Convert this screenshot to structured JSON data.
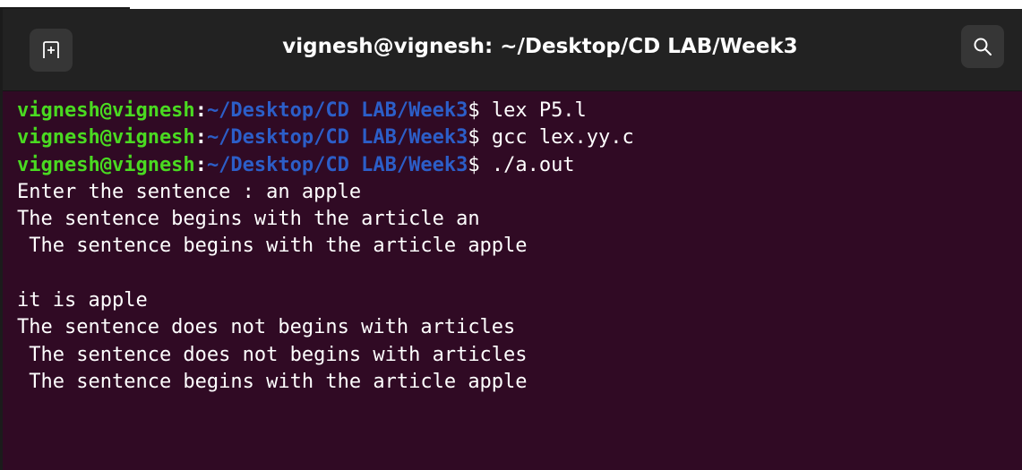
{
  "window": {
    "title": "vignesh@vignesh: ~/Desktop/CD LAB/Week3"
  },
  "icons": {
    "new_tab": "new-tab-icon",
    "search": "search-icon"
  },
  "colors": {
    "background": "#300a24",
    "titlebar": "#222222",
    "prompt_user": "#4ada21",
    "prompt_path": "#2c5ec8",
    "text": "#ffffff"
  },
  "terminal": {
    "prompts": [
      {
        "user": "vignesh@vignesh",
        "sep": ":",
        "path": "~/Desktop/CD LAB/Week3",
        "symbol": "$",
        "command": " lex P5.l"
      },
      {
        "user": "vignesh@vignesh",
        "sep": ":",
        "path": "~/Desktop/CD LAB/Week3",
        "symbol": "$",
        "command": " gcc lex.yy.c"
      },
      {
        "user": "vignesh@vignesh",
        "sep": ":",
        "path": "~/Desktop/CD LAB/Week3",
        "symbol": "$",
        "command": " ./a.out"
      }
    ],
    "output": [
      "Enter the sentence : an apple",
      "The sentence begins with the article an",
      " The sentence begins with the article apple",
      "",
      "it is apple",
      "The sentence does not begins with articles",
      " The sentence does not begins with articles",
      " The sentence begins with the article apple"
    ]
  }
}
